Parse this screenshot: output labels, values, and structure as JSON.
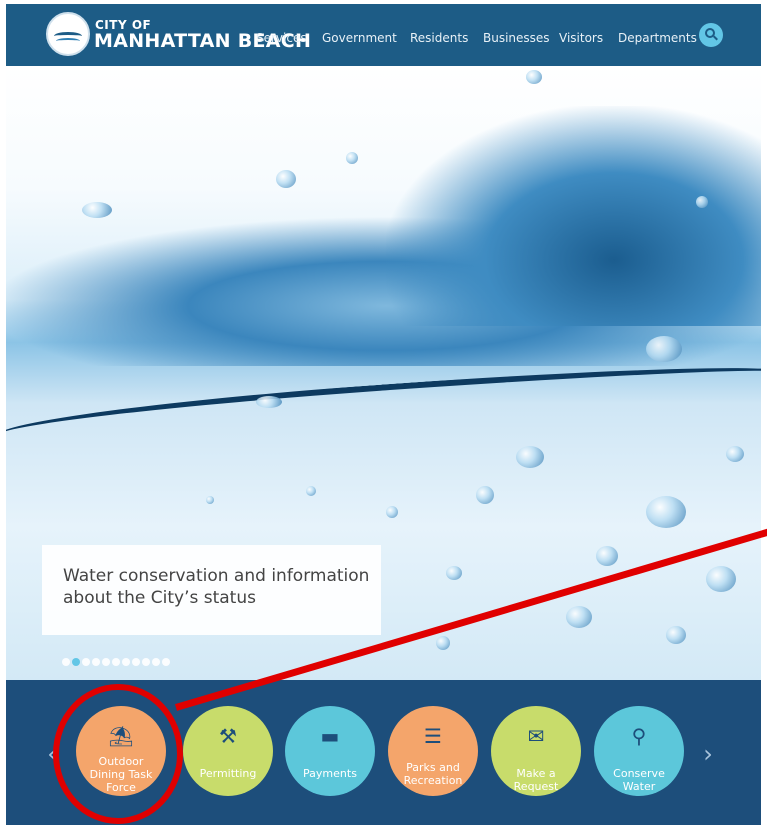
{
  "header": {
    "brand_top": "CITY OF",
    "brand_main": "MANHATTAN BEACH",
    "nav": [
      "Services",
      "Government",
      "Residents",
      "Businesses",
      "Visitors",
      "Departments"
    ],
    "search_icon": "search-icon",
    "background": "#1d5c86"
  },
  "hero": {
    "caption": "Water conservation and information about the City’s status",
    "slides": {
      "total": 11,
      "active": 2
    }
  },
  "quicklinks": {
    "prev_arrow": "‹",
    "next_arrow": "›",
    "items": [
      {
        "label": "Outdoor Dining Task Force",
        "icon": "outdoor-dining-icon",
        "glyph": "⛱",
        "color": "#f4a56b"
      },
      {
        "label": "Permitting",
        "icon": "stamp-icon",
        "glyph": "⚒",
        "color": "#c8dc6b"
      },
      {
        "label": "Payments",
        "icon": "credit-card-icon",
        "glyph": "▬",
        "color": "#5cc7da"
      },
      {
        "label": "Parks and Recreation",
        "icon": "clipboard-icon",
        "glyph": "☰",
        "color": "#f4a56b"
      },
      {
        "label": "Make a Request",
        "icon": "request-form-icon",
        "glyph": "✉",
        "color": "#c8dc6b"
      },
      {
        "label": "Conserve Water",
        "icon": "water-faucet-icon",
        "glyph": "⚲",
        "color": "#5cc7da"
      }
    ]
  },
  "annotation": {
    "color": "#e00000"
  }
}
